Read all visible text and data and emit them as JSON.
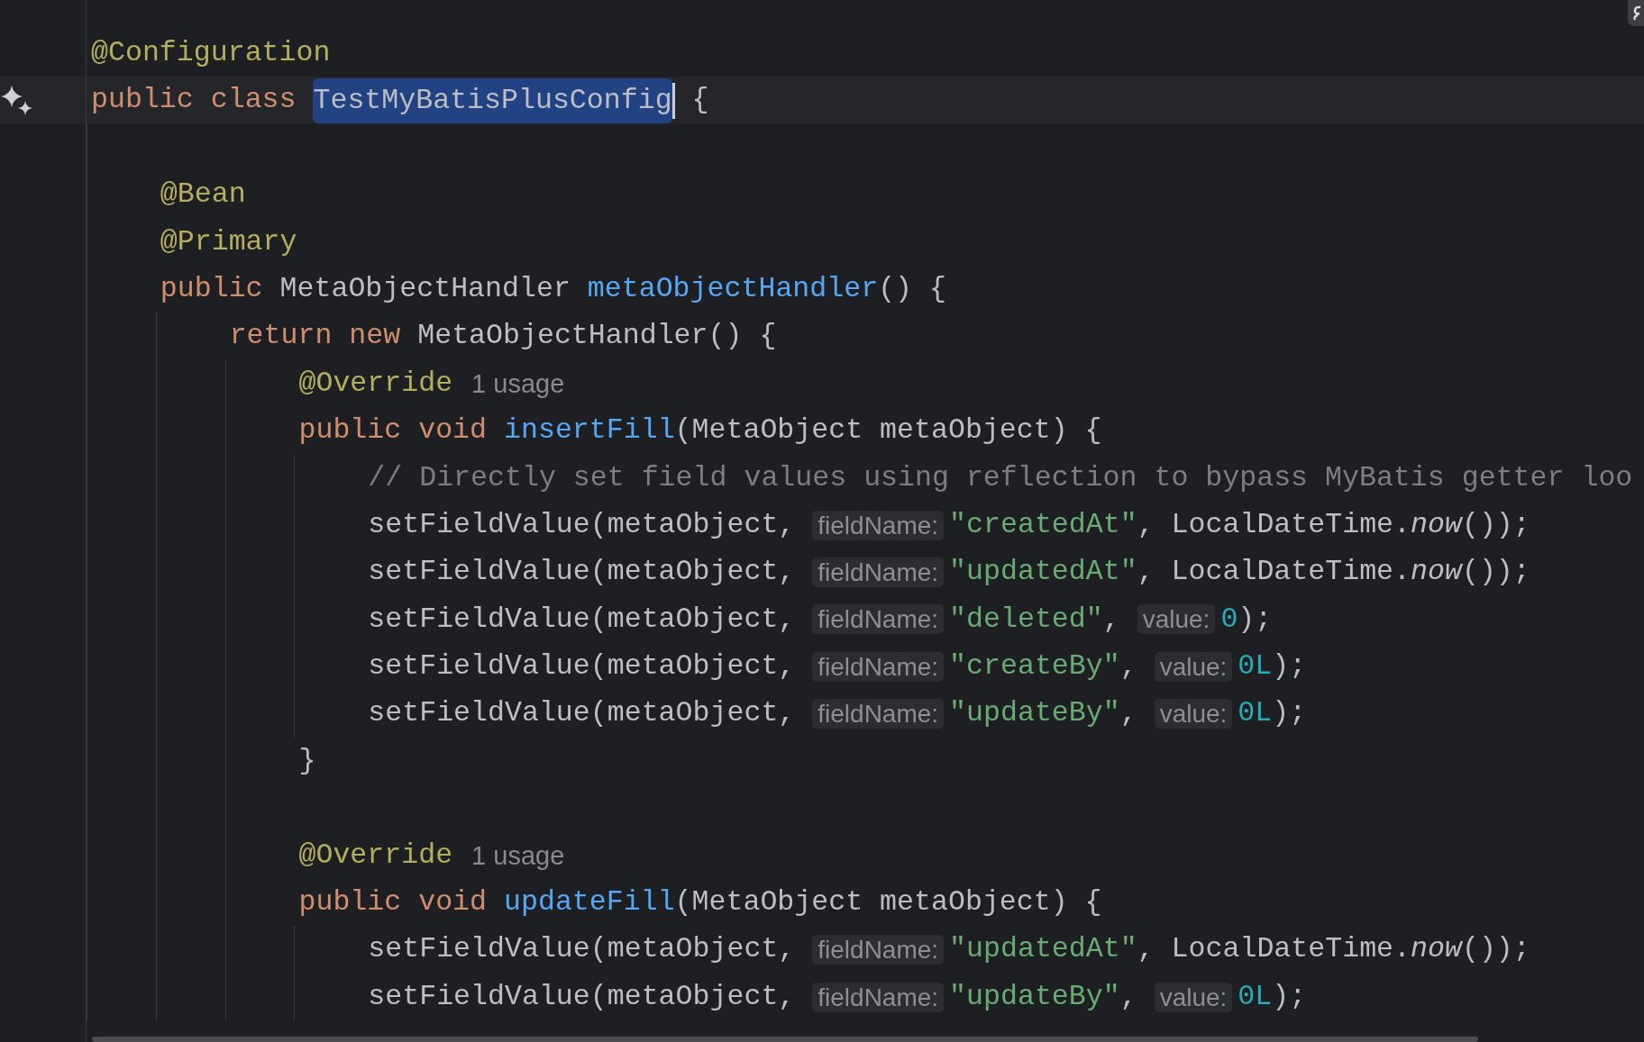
{
  "lines": [
    {
      "kind": "code",
      "tokens": [
        {
          "kind": "annotation",
          "text": "@Configuration"
        }
      ]
    },
    {
      "kind": "code",
      "current": true,
      "gutter_action": true,
      "tokens": [
        {
          "kind": "keyword",
          "text": "public class "
        },
        {
          "kind": "plain",
          "text": "TestMyBatisPlusConfig",
          "selected": true,
          "caret": true
        },
        {
          "kind": "plain",
          "text": " {"
        }
      ],
      "children": [
        {
          "kind": "blank"
        },
        {
          "kind": "code",
          "tokens": [
            {
              "kind": "annotation",
              "text": "@Bean"
            }
          ]
        },
        {
          "kind": "code",
          "tokens": [
            {
              "kind": "annotation",
              "text": "@Primary"
            }
          ]
        },
        {
          "kind": "code",
          "tokens": [
            {
              "kind": "keyword",
              "text": "public "
            },
            {
              "kind": "plain",
              "text": "MetaObjectHandler "
            },
            {
              "kind": "method",
              "text": "metaObjectHandler"
            },
            {
              "kind": "plain",
              "text": "() {"
            }
          ],
          "children": [
            {
              "kind": "code",
              "tokens": [
                {
                  "kind": "keyword",
                  "text": "return new "
                },
                {
                  "kind": "plain",
                  "text": "MetaObjectHandler() {"
                }
              ],
              "children": [
                {
                  "kind": "code",
                  "tokens": [
                    {
                      "kind": "annotation",
                      "text": "@Override"
                    },
                    {
                      "kind": "usage",
                      "text": "1 usage"
                    }
                  ]
                },
                {
                  "kind": "code",
                  "tokens": [
                    {
                      "kind": "keyword",
                      "text": "public void "
                    },
                    {
                      "kind": "method",
                      "text": "insertFill"
                    },
                    {
                      "kind": "plain",
                      "text": "(MetaObject metaObject) {"
                    }
                  ],
                  "children": [
                    {
                      "kind": "code",
                      "tokens": [
                        {
                          "kind": "comment",
                          "text": "// Directly set field values using reflection to bypass MyBatis getter loo"
                        }
                      ]
                    },
                    {
                      "kind": "code",
                      "tokens": [
                        {
                          "kind": "plain",
                          "text": "setFieldValue(metaObject, "
                        },
                        {
                          "kind": "hint",
                          "text": "fieldName:"
                        },
                        {
                          "kind": "string",
                          "text": "\"createdAt\""
                        },
                        {
                          "kind": "plain",
                          "text": ", LocalDateTime."
                        },
                        {
                          "kind": "static",
                          "text": "now"
                        },
                        {
                          "kind": "plain",
                          "text": "());"
                        }
                      ]
                    },
                    {
                      "kind": "code",
                      "tokens": [
                        {
                          "kind": "plain",
                          "text": "setFieldValue(metaObject, "
                        },
                        {
                          "kind": "hint",
                          "text": "fieldName:"
                        },
                        {
                          "kind": "string",
                          "text": "\"updatedAt\""
                        },
                        {
                          "kind": "plain",
                          "text": ", LocalDateTime."
                        },
                        {
                          "kind": "static",
                          "text": "now"
                        },
                        {
                          "kind": "plain",
                          "text": "());"
                        }
                      ]
                    },
                    {
                      "kind": "code",
                      "tokens": [
                        {
                          "kind": "plain",
                          "text": "setFieldValue(metaObject, "
                        },
                        {
                          "kind": "hint",
                          "text": "fieldName:"
                        },
                        {
                          "kind": "string",
                          "text": "\"deleted\""
                        },
                        {
                          "kind": "plain",
                          "text": ", "
                        },
                        {
                          "kind": "hint",
                          "text": "value:"
                        },
                        {
                          "kind": "number",
                          "text": "0"
                        },
                        {
                          "kind": "plain",
                          "text": ");"
                        }
                      ]
                    },
                    {
                      "kind": "code",
                      "tokens": [
                        {
                          "kind": "plain",
                          "text": "setFieldValue(metaObject, "
                        },
                        {
                          "kind": "hint",
                          "text": "fieldName:"
                        },
                        {
                          "kind": "string",
                          "text": "\"createBy\""
                        },
                        {
                          "kind": "plain",
                          "text": ", "
                        },
                        {
                          "kind": "hint",
                          "text": "value:"
                        },
                        {
                          "kind": "number",
                          "text": "0L"
                        },
                        {
                          "kind": "plain",
                          "text": ");"
                        }
                      ]
                    },
                    {
                      "kind": "code",
                      "tokens": [
                        {
                          "kind": "plain",
                          "text": "setFieldValue(metaObject, "
                        },
                        {
                          "kind": "hint",
                          "text": "fieldName:"
                        },
                        {
                          "kind": "string",
                          "text": "\"updateBy\""
                        },
                        {
                          "kind": "plain",
                          "text": ", "
                        },
                        {
                          "kind": "hint",
                          "text": "value:"
                        },
                        {
                          "kind": "number",
                          "text": "0L"
                        },
                        {
                          "kind": "plain",
                          "text": ");"
                        }
                      ]
                    }
                  ]
                },
                {
                  "kind": "code",
                  "tokens": [
                    {
                      "kind": "plain",
                      "text": "}"
                    }
                  ]
                },
                {
                  "kind": "blank"
                },
                {
                  "kind": "code",
                  "tokens": [
                    {
                      "kind": "annotation",
                      "text": "@Override"
                    },
                    {
                      "kind": "usage",
                      "text": "1 usage"
                    }
                  ]
                },
                {
                  "kind": "code",
                  "tokens": [
                    {
                      "kind": "keyword",
                      "text": "public void "
                    },
                    {
                      "kind": "method",
                      "text": "updateFill"
                    },
                    {
                      "kind": "plain",
                      "text": "(MetaObject metaObject) {"
                    }
                  ],
                  "children": [
                    {
                      "kind": "code",
                      "tokens": [
                        {
                          "kind": "plain",
                          "text": "setFieldValue(metaObject, "
                        },
                        {
                          "kind": "hint",
                          "text": "fieldName:"
                        },
                        {
                          "kind": "string",
                          "text": "\"updatedAt\""
                        },
                        {
                          "kind": "plain",
                          "text": ", LocalDateTime."
                        },
                        {
                          "kind": "static",
                          "text": "now"
                        },
                        {
                          "kind": "plain",
                          "text": "());"
                        }
                      ]
                    },
                    {
                      "kind": "code",
                      "tokens": [
                        {
                          "kind": "plain",
                          "text": "setFieldValue(metaObject, "
                        },
                        {
                          "kind": "hint",
                          "text": "fieldName:"
                        },
                        {
                          "kind": "string",
                          "text": "\"updateBy\""
                        },
                        {
                          "kind": "plain",
                          "text": ", "
                        },
                        {
                          "kind": "hint",
                          "text": "value:"
                        },
                        {
                          "kind": "number",
                          "text": "0L"
                        },
                        {
                          "kind": "plain",
                          "text": ");"
                        }
                      ]
                    }
                  ]
                }
              ]
            }
          ]
        }
      ]
    }
  ]
}
